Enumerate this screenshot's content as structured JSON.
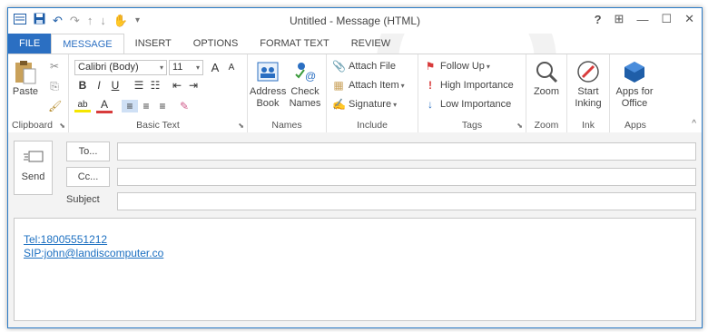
{
  "window": {
    "title": "Untitled - Message (HTML)",
    "controls": {
      "help": "?",
      "ribbon_display": "⊞",
      "minimize": "—",
      "maximize": "☐",
      "close": "✕"
    }
  },
  "qat": {
    "undo": "↶",
    "redo": "↷",
    "up": "↑",
    "down": "↓",
    "customize": "▾"
  },
  "tabs": [
    {
      "label": "FILE"
    },
    {
      "label": "MESSAGE"
    },
    {
      "label": "INSERT"
    },
    {
      "label": "OPTIONS"
    },
    {
      "label": "FORMAT TEXT"
    },
    {
      "label": "REVIEW"
    }
  ],
  "ribbon": {
    "clipboard": {
      "label": "Clipboard",
      "paste": "Paste"
    },
    "basic_text": {
      "label": "Basic Text",
      "font": "Calibri (Body)",
      "size": "11",
      "grow": "A",
      "shrink": "A",
      "bold": "B",
      "italic": "I",
      "underline": "U",
      "font_color": "A",
      "highlight": "ab"
    },
    "names": {
      "label": "Names",
      "address_book": [
        "Address",
        "Book"
      ],
      "check_names": [
        "Check",
        "Names"
      ]
    },
    "include": {
      "label": "Include",
      "attach_file": "Attach File",
      "attach_item": "Attach Item",
      "signature": "Signature"
    },
    "tags": {
      "label": "Tags",
      "follow_up": "Follow Up",
      "high_importance": "High Importance",
      "low_importance": "Low Importance"
    },
    "zoom": {
      "label": "Zoom",
      "button": "Zoom"
    },
    "ink": {
      "label": "Ink",
      "start_inking": [
        "Start",
        "Inking"
      ]
    },
    "apps": {
      "label": "Apps",
      "apps_for_office": [
        "Apps for",
        "Office"
      ]
    }
  },
  "compose": {
    "send": "Send",
    "to_button": "To...",
    "cc_button": "Cc...",
    "subject_label": "Subject",
    "to_value": "",
    "cc_value": "",
    "subject_value": ""
  },
  "body": {
    "links": [
      "Tel:18005551212",
      "SIP:john@landiscomputer.co"
    ]
  },
  "colors": {
    "accent": "#2b6fc2",
    "link": "#1b6fc1",
    "flag": "#d83b3b"
  }
}
